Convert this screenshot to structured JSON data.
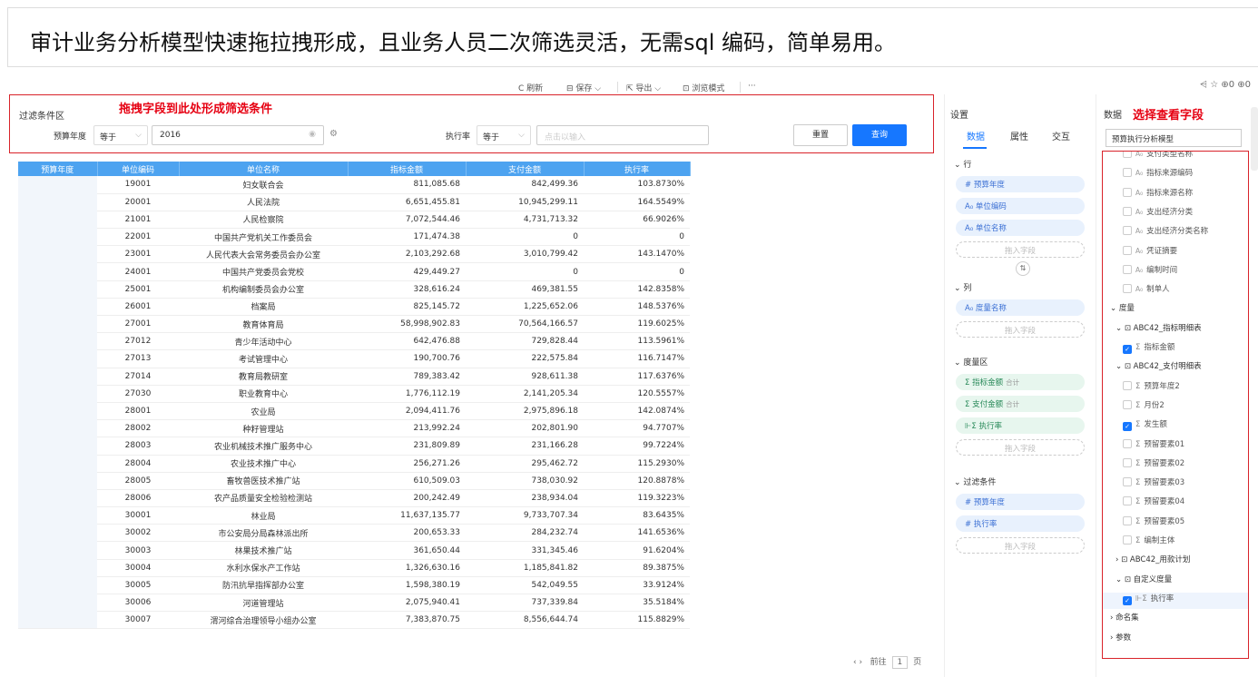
{
  "banner": {
    "text": "审计业务分析模型快速拖拉拽形成，且业务人员二次筛选灵活，无需sql 编码，简单易用。"
  },
  "toolbar": {
    "refresh": "C 刷新",
    "save": "保存 ⌵",
    "export": "导出 ⌵",
    "browse": "浏览模式",
    "more": "···",
    "right_icons": "⩤  ☆  ⊕0  ⊕0"
  },
  "filter": {
    "title": "过滤条件区",
    "hint": "拖拽字段到此处形成筛选条件",
    "field1_label": "预算年度",
    "field1_op": "等于",
    "field1_value": "2016",
    "field2_label": "执行率",
    "field2_op": "等于",
    "field2_placeholder": "点击以输入",
    "reset": "重置",
    "query": "查询"
  },
  "table": {
    "headers": [
      "预算年度",
      "单位编码",
      "单位名称",
      "指标金额",
      "支付金额",
      "执行率"
    ],
    "rows": [
      [
        "19001",
        "妇女联合会",
        "811,085.68",
        "842,499.36",
        "103.8730%",
        "red"
      ],
      [
        "20001",
        "人民法院",
        "6,651,455.81",
        "10,945,299.11",
        "164.5549%",
        "red"
      ],
      [
        "21001",
        "人民检察院",
        "7,072,544.46",
        "4,731,713.32",
        "66.9026%",
        "green"
      ],
      [
        "22001",
        "中国共产党机关工作委员会",
        "171,474.38",
        "0",
        "0",
        "plain"
      ],
      [
        "23001",
        "人民代表大会常务委员会办公室",
        "2,103,292.68",
        "3,010,799.42",
        "143.1470%",
        "red"
      ],
      [
        "24001",
        "中国共产党委员会党校",
        "429,449.27",
        "0",
        "0",
        "plain"
      ],
      [
        "25001",
        "机构编制委员会办公室",
        "328,616.24",
        "469,381.55",
        "142.8358%",
        "red"
      ],
      [
        "26001",
        "档案局",
        "825,145.72",
        "1,225,652.06",
        "148.5376%",
        "red"
      ],
      [
        "27001",
        "教育体育局",
        "58,998,902.83",
        "70,564,166.57",
        "119.6025%",
        "red"
      ],
      [
        "27012",
        "青少年活动中心",
        "642,476.88",
        "729,828.44",
        "113.5961%",
        "red"
      ],
      [
        "27013",
        "考试管理中心",
        "190,700.76",
        "222,575.84",
        "116.7147%",
        "red"
      ],
      [
        "27014",
        "教育局教研室",
        "789,383.42",
        "928,611.38",
        "117.6376%",
        "red"
      ],
      [
        "27030",
        "职业教育中心",
        "1,776,112.19",
        "2,141,205.34",
        "120.5557%",
        "red"
      ],
      [
        "28001",
        "农业局",
        "2,094,411.76",
        "2,975,896.18",
        "142.0874%",
        "red"
      ],
      [
        "28002",
        "种籽管理站",
        "213,992.24",
        "202,801.90",
        "94.7707%",
        "plain"
      ],
      [
        "28003",
        "农业机械技术推广服务中心",
        "231,809.89",
        "231,166.28",
        "99.7224%",
        "plain"
      ],
      [
        "28004",
        "农业技术推广中心",
        "256,271.26",
        "295,462.72",
        "115.2930%",
        "red"
      ],
      [
        "28005",
        "畜牧兽医技术推广站",
        "610,509.03",
        "738,030.92",
        "120.8878%",
        "red"
      ],
      [
        "28006",
        "农产品质量安全检验检测站",
        "200,242.49",
        "238,934.04",
        "119.3223%",
        "red"
      ],
      [
        "30001",
        "林业局",
        "11,637,135.77",
        "9,733,707.34",
        "83.6435%",
        "plain"
      ],
      [
        "30002",
        "市公安局分局森林派出所",
        "200,653.33",
        "284,232.74",
        "141.6536%",
        "red"
      ],
      [
        "30003",
        "林果技术推广站",
        "361,650.44",
        "331,345.46",
        "91.6204%",
        "plain"
      ],
      [
        "30004",
        "水利水保水产工作站",
        "1,326,630.16",
        "1,185,841.82",
        "89.3875%",
        "plain"
      ],
      [
        "30005",
        "防汛抗旱指挥部办公室",
        "1,598,380.19",
        "542,049.55",
        "33.9124%",
        "green"
      ],
      [
        "30006",
        "河道管理站",
        "2,075,940.41",
        "737,339.84",
        "35.5184%",
        "green"
      ],
      [
        "30007",
        "渭河综合治理领导小组办公室",
        "7,383,870.75",
        "8,556,644.74",
        "115.8829%",
        "red"
      ]
    ]
  },
  "pager": {
    "arrows": "‹  ›",
    "goto": "前往",
    "page": "1",
    "unit": "页"
  },
  "settings": {
    "title": "设置",
    "tabs": [
      "数据",
      "属性",
      "交互"
    ],
    "rows_title": "⌄ 行",
    "rows": [
      "# 预算年度",
      "A₀ 单位编码",
      "A₀ 单位名称"
    ],
    "drop": "拖入字段",
    "cols_title": "⌄ 列",
    "cols": [
      "A₀ 度量名称"
    ],
    "measure_title": "⌄ 度量区",
    "measures": [
      "Σ 指标金额",
      "Σ 支付金额",
      "⊩Σ 执行率"
    ],
    "sum_tag": "合计",
    "filter_title": "⌄ 过滤条件",
    "filters": [
      "# 预算年度",
      "# 执行率"
    ],
    "swap": "⇅"
  },
  "datapanel": {
    "title": "数据",
    "hint": "选择查看字段",
    "model": "预算执行分析模型",
    "dims": [
      "支付类型名称",
      "指标来源编码",
      "指标来源名称",
      "支出经济分类",
      "支出经济分类名称",
      "凭证摘要",
      "编制时间",
      "制单人"
    ],
    "measure_group": "⌄ 度量",
    "table1": "⌄ ⊡ ABC42_指标明细表",
    "t1_items": [
      "指标金额"
    ],
    "table2": "⌄ ⊡ ABC42_支付明细表",
    "t2_items": [
      "预算年度2",
      "月份2",
      "发生额",
      "预留要素01",
      "预留要素02",
      "预留要素03",
      "预留要素04",
      "预留要素05",
      "编制主体"
    ],
    "table3": "› ⊡ ABC42_用款计划",
    "custom": "⌄ ⊡ 自定义度量",
    "custom_items": [
      "执行率"
    ],
    "named_set": "› 命名集",
    "params": "› 参数",
    "gtag": "A₀"
  }
}
